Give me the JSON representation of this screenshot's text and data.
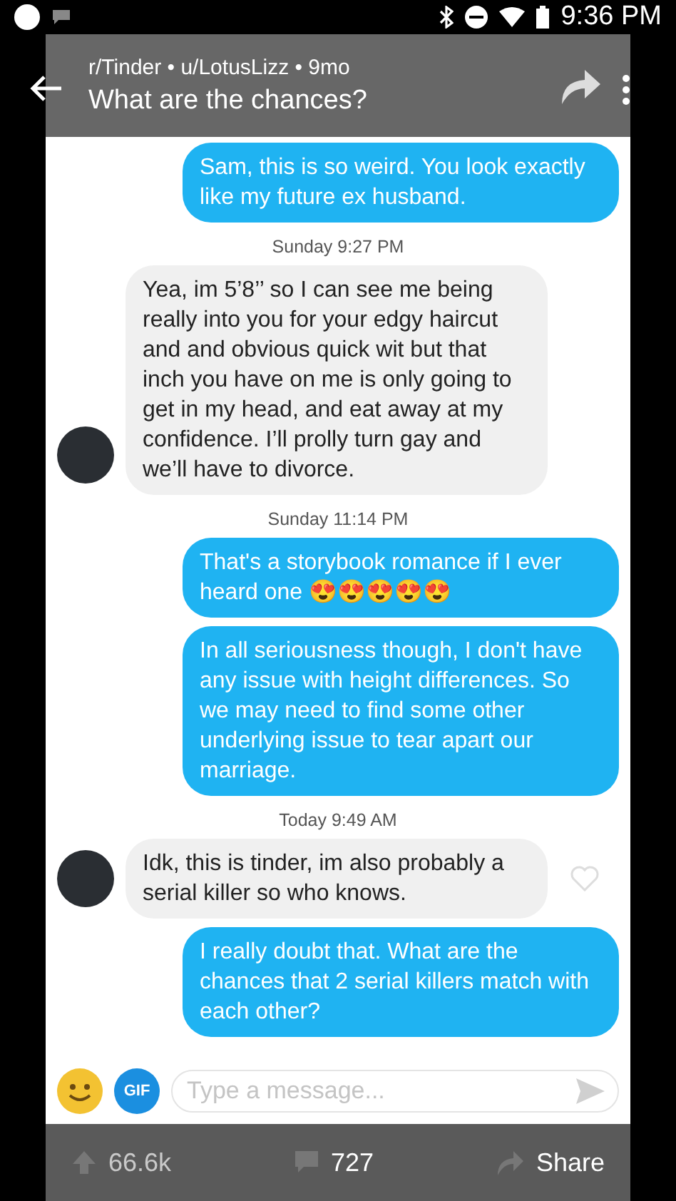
{
  "status_bar": {
    "time": "9:36 PM"
  },
  "post": {
    "meta": "r/Tinder • u/LotusLizz • 9mo",
    "title": "What are the chances?"
  },
  "chat": [
    {
      "kind": "sent",
      "text": "Sam, this is so weird. You look exactly like my future ex husband."
    },
    {
      "kind": "timestamp",
      "text": "Sunday 9:27 PM"
    },
    {
      "kind": "received",
      "text": "Yea, im 5’8’’ so I can see me being really into you for your edgy haircut and and obvious quick wit but that inch you have on me is only going to get in my head, and eat away at my confidence. I’ll prolly turn gay and we’ll have to divorce.",
      "like_button": false
    },
    {
      "kind": "timestamp",
      "text": "Sunday 11:14 PM"
    },
    {
      "kind": "sent",
      "text": "That's a storybook romance if I ever heard one 😍😍😍😍😍"
    },
    {
      "kind": "sent",
      "text": "In all seriousness though, I don't have any issue with height differences. So we may need to find some other underlying issue to tear apart our marriage."
    },
    {
      "kind": "timestamp",
      "text": "Today 9:49 AM"
    },
    {
      "kind": "received",
      "text": "Idk, this is tinder, im also probably a serial killer so who knows.",
      "like_button": true
    },
    {
      "kind": "sent",
      "text": "I really doubt that. What are the chances that 2 serial killers match with each other?"
    }
  ],
  "composer": {
    "gif": "GIF",
    "placeholder": "Type a message..."
  },
  "actions": {
    "votes": "66.6k",
    "comments": "727",
    "share": "Share"
  }
}
